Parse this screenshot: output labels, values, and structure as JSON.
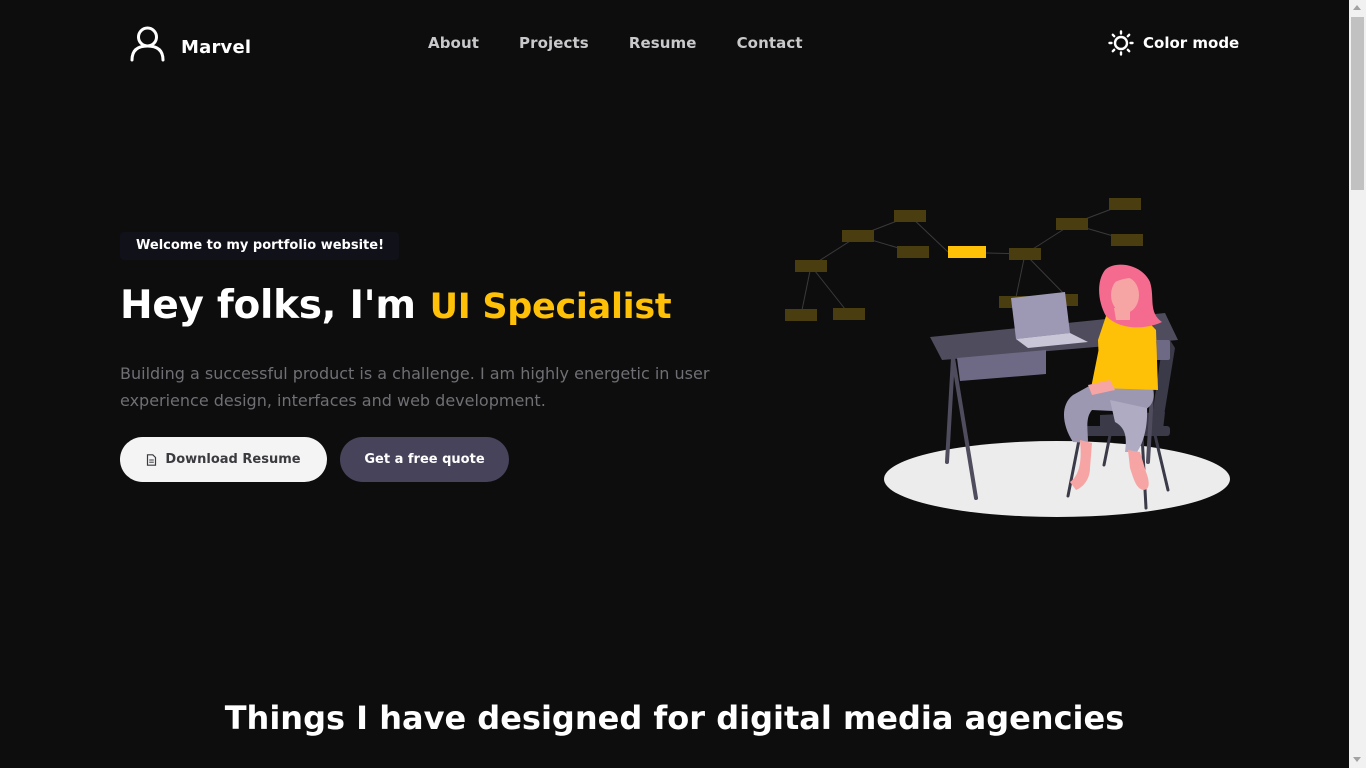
{
  "header": {
    "brand_name": "Marvel",
    "brand_icon": "user-icon",
    "nav": [
      "About",
      "Projects",
      "Resume",
      "Contact"
    ],
    "color_mode_label": "Color mode",
    "color_mode_icon": "sun-icon"
  },
  "hero": {
    "welcome_badge": "Welcome to my portfolio website!",
    "title_prefix": "Hey folks, I'm",
    "title_accent": "UI Specialist",
    "description": "Building a successful product is a challenge. I am highly energetic in user experience design, interfaces and web development.",
    "download_button": "Download Resume",
    "download_icon": "document-icon",
    "quote_button": "Get a free quote",
    "illustration": "woman-at-desk-with-laptop-illustration"
  },
  "section": {
    "title": "Things I have designed for digital media agencies"
  },
  "colors": {
    "background": "#0d0d0e",
    "accent": "#ffc107",
    "button_light": "#f4f4f4",
    "button_dark": "#47435a",
    "muted_text": "#6f6f74"
  }
}
